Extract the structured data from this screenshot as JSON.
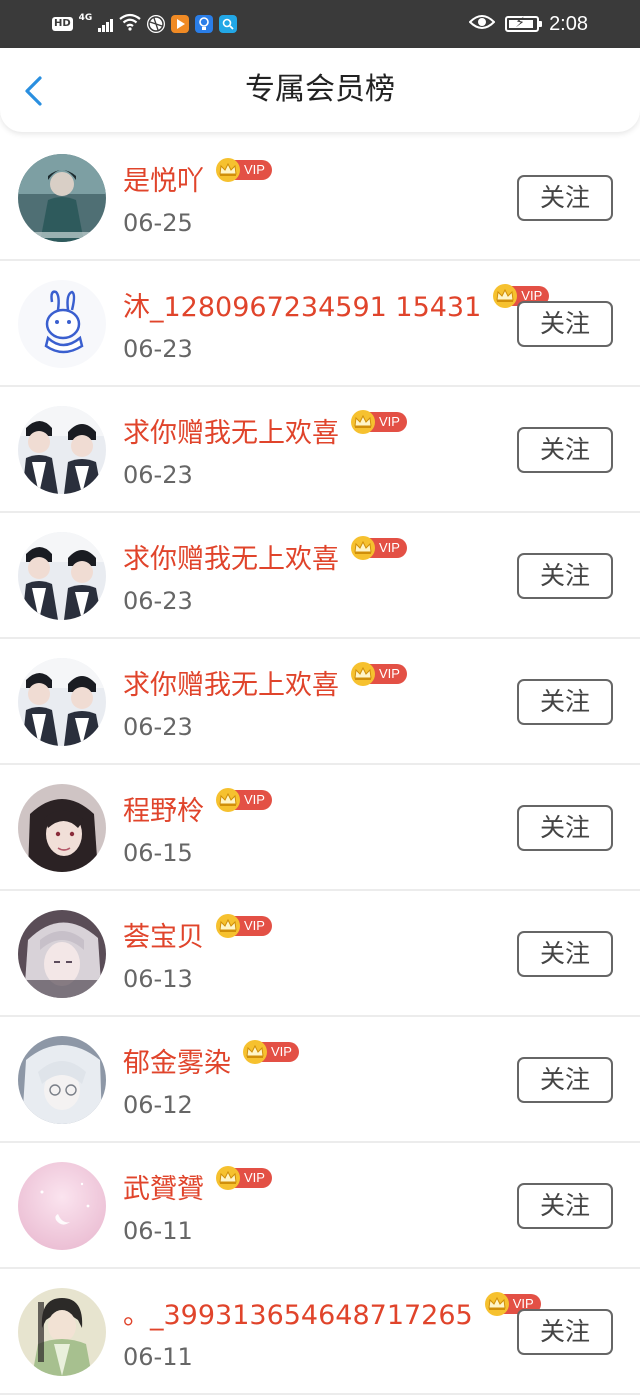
{
  "status_bar": {
    "left_labels": {
      "hd": "HD",
      "network": "4G"
    },
    "time": "2:08"
  },
  "header": {
    "title": "专属会员榜",
    "back_icon": "chevron-left-icon",
    "accent_color": "#2a8fe0"
  },
  "vip_label": "VIP",
  "follow_label": "关注",
  "colors": {
    "username": "#e0442b",
    "vip_tag": "#e35045",
    "crown": "#f6c12f"
  },
  "members": [
    {
      "name": "是悦吖",
      "date": "06-25",
      "avatar": "avatar-teal-figure"
    },
    {
      "name": "沐_1280967234591 15431",
      "date": "06-23",
      "avatar": "avatar-bunny-drawing"
    },
    {
      "name": "求你赠我无上欢喜",
      "date": "06-23",
      "avatar": "avatar-two-figures"
    },
    {
      "name": "求你赠我无上欢喜",
      "date": "06-23",
      "avatar": "avatar-two-figures"
    },
    {
      "name": "求你赠我无上欢喜",
      "date": "06-23",
      "avatar": "avatar-two-figures"
    },
    {
      "name": "程野柃",
      "date": "06-15",
      "avatar": "avatar-dark-hair"
    },
    {
      "name": "荟宝贝",
      "date": "06-13",
      "avatar": "avatar-silver-hair"
    },
    {
      "name": "郁金雾染",
      "date": "06-12",
      "avatar": "avatar-white-hair"
    },
    {
      "name": "武贇贇",
      "date": "06-11",
      "avatar": "avatar-pink-moon"
    },
    {
      "name": "。_399313654648717265",
      "date": "06-11",
      "avatar": "avatar-green-robe"
    }
  ]
}
